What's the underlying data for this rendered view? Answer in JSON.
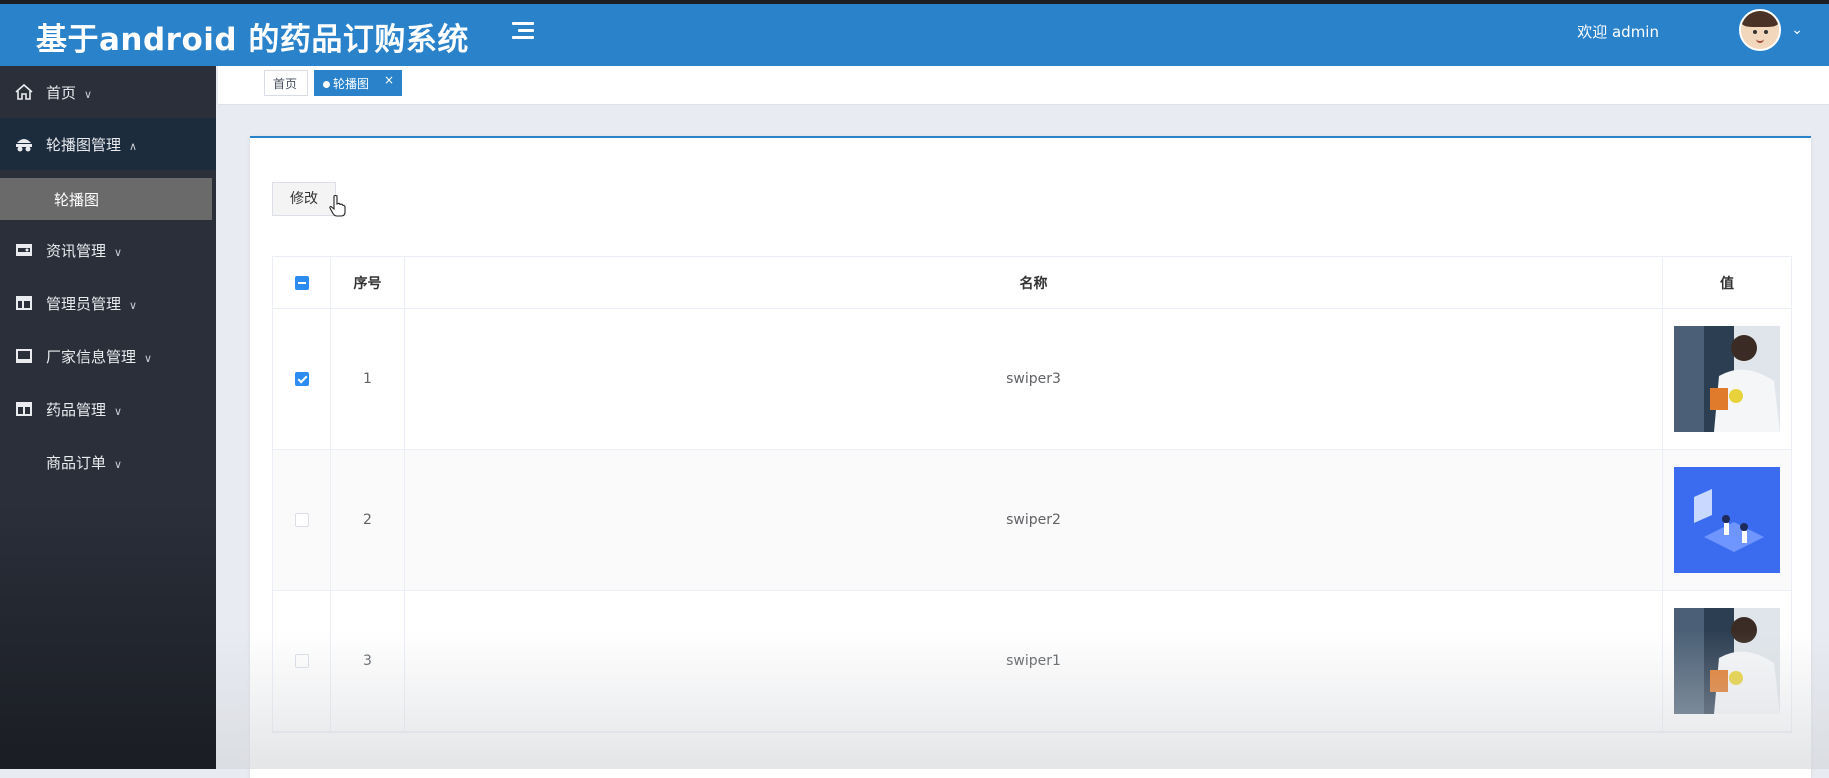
{
  "header": {
    "title": "基于android 的药品订购系统",
    "welcome": "欢迎 admin",
    "menu_icon": "hamburger-icon"
  },
  "sidebar": {
    "items": [
      {
        "label": "首页",
        "icon": "home-icon"
      },
      {
        "label": "轮播图管理",
        "icon": "carousel-icon"
      },
      {
        "label": "资讯管理",
        "icon": "news-icon"
      },
      {
        "label": "管理员管理",
        "icon": "admin-icon"
      },
      {
        "label": "厂家信息管理",
        "icon": "factory-icon"
      },
      {
        "label": "药品管理",
        "icon": "medicine-icon"
      },
      {
        "label": "商品订单",
        "icon": ""
      }
    ],
    "sub_item": "轮播图"
  },
  "tabs": [
    {
      "label": "首页"
    },
    {
      "label": "轮播图"
    }
  ],
  "toolbar": {
    "edit_label": "修改"
  },
  "table": {
    "columns": [
      "序号",
      "名称",
      "值"
    ],
    "rows": [
      {
        "index": "1",
        "name": "swiper3",
        "checked": true,
        "image": "lab-photo"
      },
      {
        "index": "2",
        "name": "swiper2",
        "checked": false,
        "image": "blue-illustration"
      },
      {
        "index": "3",
        "name": "swiper1",
        "checked": false,
        "image": "lab-photo"
      }
    ]
  },
  "colors": {
    "primary": "#2a82cb",
    "sidebar": "#2b2f3a",
    "checkbox": "#2d8cf0"
  }
}
